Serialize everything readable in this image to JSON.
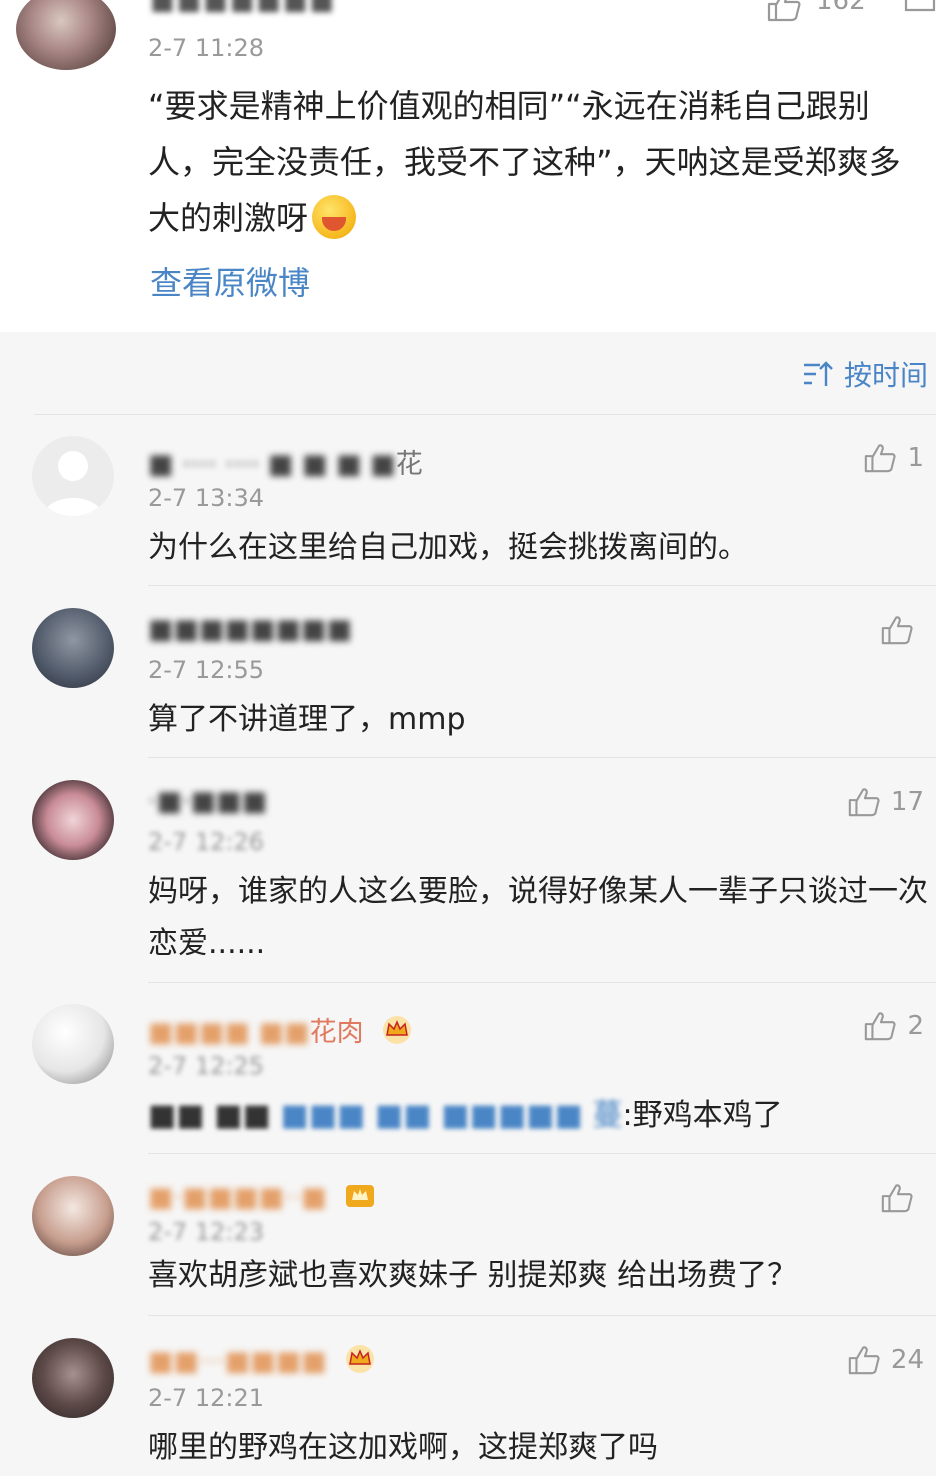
{
  "top_post": {
    "username": "■■■■■■■",
    "time": "2-7 11:28",
    "like_count": "162",
    "content": "“要求是精神上价值观的相同”“永远在消耗自己跟别人，完全没责任，我受不了这种”，天呐这是受郑爽多大的刺激呀",
    "emoji_name": "yum-emoji-icon",
    "view_original_label": "查看原微博"
  },
  "sort": {
    "label": "按时间",
    "icon": "sort-icon"
  },
  "comments": [
    {
      "username_blur": "■ ···· ···· ■ ■ ■ ■ ",
      "username_clear": "花",
      "time": "2-7 13:34",
      "text": "为什么在这里给自己加戏，挺会挑拨离间的。",
      "likes": "1",
      "avatar_color": "#e6e6e6"
    },
    {
      "username_blur": "■■■■■■■■",
      "username_clear": "",
      "time": "2-7 12:55",
      "text": "算了不讲道理了，mmp",
      "likes": "",
      "avatar_color": "#6c7380"
    },
    {
      "username_blur": "·■·■■■",
      "username_clear": "",
      "time": "2-7 12:26",
      "text": "妈呀，谁家的人这么要脸，说得好像某人一辈子只谈过一次恋爱......",
      "likes": "17",
      "avatar_color": "#cfa6ae"
    },
    {
      "username_blur": "■■■■ ■■",
      "username_clear": "花肉",
      "time": "2-7 12:25",
      "text_prefix_dark": "■■ ■■",
      "text_prefix_link": "■■■ ■■ ■■■■■ 蔓",
      "text": ":野鸡本鸡了",
      "likes": "2",
      "avatar_color": "#d8d8d8"
    },
    {
      "username_blur": "■·■■■■··■",
      "username_clear": "",
      "time": "2-7 12:23",
      "text": "喜欢胡彦斌也喜欢爽妹子 别提郑爽 给出场费了？",
      "likes": "",
      "avatar_color": "#c9a89c"
    },
    {
      "username_blur": "■■···■■■■",
      "username_clear": "",
      "time": "2-7 12:21",
      "text": "哪里的野鸡在这加戏啊，这提郑爽了吗",
      "likes": "24",
      "avatar_color": "#6a5a58"
    }
  ]
}
